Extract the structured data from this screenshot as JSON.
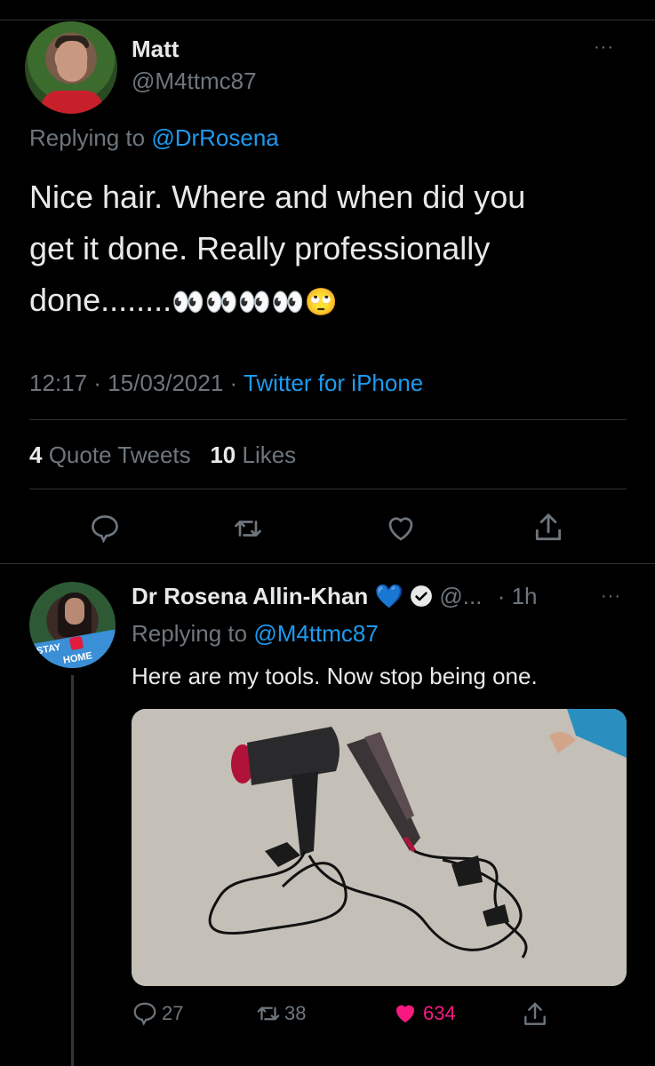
{
  "tweet": {
    "author_name": "Matt",
    "author_handle": "@M4ttmc87",
    "replying_prefix": "Replying to",
    "replying_to": "@DrRosena",
    "text_line1": "Nice hair. Where and when did you",
    "text_line2": "get it done. Really professionally",
    "text_line3": "done........",
    "emojis": "👀👀👀👀🙄",
    "time": "12:17 · 15/03/2021 · ",
    "source": "Twitter for iPhone",
    "quote_count": "4",
    "quote_label": "Quote Tweets",
    "like_count": "10",
    "like_label": "Likes",
    "more": "···"
  },
  "reply": {
    "author_name": "Dr Rosena Allin-Khan",
    "heart_emoji": "💙",
    "handle": "@...",
    "time": "· 1h",
    "replying_prefix": "Replying to",
    "replying_to": "@M4ttmc87",
    "text": "Here are my tools. Now stop being one.",
    "avatar_badge_top": "STAY",
    "avatar_badge_bottom": "HOME",
    "reply_count": "27",
    "retweet_count": "38",
    "like_count": "634",
    "more": "···"
  },
  "colors": {
    "background": "#000000",
    "link": "#1d9bf0",
    "like_active": "#f91880",
    "muted": "#6e767d"
  },
  "icons": [
    "reply-icon",
    "retweet-icon",
    "like-icon",
    "share-icon",
    "verified-icon",
    "more-icon"
  ]
}
